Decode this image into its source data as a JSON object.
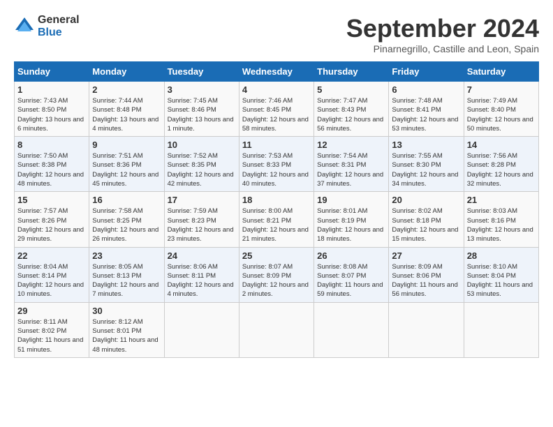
{
  "header": {
    "logo_line1": "General",
    "logo_line2": "Blue",
    "month_title": "September 2024",
    "location": "Pinarnegrillo, Castille and Leon, Spain"
  },
  "weekdays": [
    "Sunday",
    "Monday",
    "Tuesday",
    "Wednesday",
    "Thursday",
    "Friday",
    "Saturday"
  ],
  "weeks": [
    [
      {
        "day": "1",
        "info": "Sunrise: 7:43 AM\nSunset: 8:50 PM\nDaylight: 13 hours and 6 minutes."
      },
      {
        "day": "2",
        "info": "Sunrise: 7:44 AM\nSunset: 8:48 PM\nDaylight: 13 hours and 4 minutes."
      },
      {
        "day": "3",
        "info": "Sunrise: 7:45 AM\nSunset: 8:46 PM\nDaylight: 13 hours and 1 minute."
      },
      {
        "day": "4",
        "info": "Sunrise: 7:46 AM\nSunset: 8:45 PM\nDaylight: 12 hours and 58 minutes."
      },
      {
        "day": "5",
        "info": "Sunrise: 7:47 AM\nSunset: 8:43 PM\nDaylight: 12 hours and 56 minutes."
      },
      {
        "day": "6",
        "info": "Sunrise: 7:48 AM\nSunset: 8:41 PM\nDaylight: 12 hours and 53 minutes."
      },
      {
        "day": "7",
        "info": "Sunrise: 7:49 AM\nSunset: 8:40 PM\nDaylight: 12 hours and 50 minutes."
      }
    ],
    [
      {
        "day": "8",
        "info": "Sunrise: 7:50 AM\nSunset: 8:38 PM\nDaylight: 12 hours and 48 minutes."
      },
      {
        "day": "9",
        "info": "Sunrise: 7:51 AM\nSunset: 8:36 PM\nDaylight: 12 hours and 45 minutes."
      },
      {
        "day": "10",
        "info": "Sunrise: 7:52 AM\nSunset: 8:35 PM\nDaylight: 12 hours and 42 minutes."
      },
      {
        "day": "11",
        "info": "Sunrise: 7:53 AM\nSunset: 8:33 PM\nDaylight: 12 hours and 40 minutes."
      },
      {
        "day": "12",
        "info": "Sunrise: 7:54 AM\nSunset: 8:31 PM\nDaylight: 12 hours and 37 minutes."
      },
      {
        "day": "13",
        "info": "Sunrise: 7:55 AM\nSunset: 8:30 PM\nDaylight: 12 hours and 34 minutes."
      },
      {
        "day": "14",
        "info": "Sunrise: 7:56 AM\nSunset: 8:28 PM\nDaylight: 12 hours and 32 minutes."
      }
    ],
    [
      {
        "day": "15",
        "info": "Sunrise: 7:57 AM\nSunset: 8:26 PM\nDaylight: 12 hours and 29 minutes."
      },
      {
        "day": "16",
        "info": "Sunrise: 7:58 AM\nSunset: 8:25 PM\nDaylight: 12 hours and 26 minutes."
      },
      {
        "day": "17",
        "info": "Sunrise: 7:59 AM\nSunset: 8:23 PM\nDaylight: 12 hours and 23 minutes."
      },
      {
        "day": "18",
        "info": "Sunrise: 8:00 AM\nSunset: 8:21 PM\nDaylight: 12 hours and 21 minutes."
      },
      {
        "day": "19",
        "info": "Sunrise: 8:01 AM\nSunset: 8:19 PM\nDaylight: 12 hours and 18 minutes."
      },
      {
        "day": "20",
        "info": "Sunrise: 8:02 AM\nSunset: 8:18 PM\nDaylight: 12 hours and 15 minutes."
      },
      {
        "day": "21",
        "info": "Sunrise: 8:03 AM\nSunset: 8:16 PM\nDaylight: 12 hours and 13 minutes."
      }
    ],
    [
      {
        "day": "22",
        "info": "Sunrise: 8:04 AM\nSunset: 8:14 PM\nDaylight: 12 hours and 10 minutes."
      },
      {
        "day": "23",
        "info": "Sunrise: 8:05 AM\nSunset: 8:13 PM\nDaylight: 12 hours and 7 minutes."
      },
      {
        "day": "24",
        "info": "Sunrise: 8:06 AM\nSunset: 8:11 PM\nDaylight: 12 hours and 4 minutes."
      },
      {
        "day": "25",
        "info": "Sunrise: 8:07 AM\nSunset: 8:09 PM\nDaylight: 12 hours and 2 minutes."
      },
      {
        "day": "26",
        "info": "Sunrise: 8:08 AM\nSunset: 8:07 PM\nDaylight: 11 hours and 59 minutes."
      },
      {
        "day": "27",
        "info": "Sunrise: 8:09 AM\nSunset: 8:06 PM\nDaylight: 11 hours and 56 minutes."
      },
      {
        "day": "28",
        "info": "Sunrise: 8:10 AM\nSunset: 8:04 PM\nDaylight: 11 hours and 53 minutes."
      }
    ],
    [
      {
        "day": "29",
        "info": "Sunrise: 8:11 AM\nSunset: 8:02 PM\nDaylight: 11 hours and 51 minutes."
      },
      {
        "day": "30",
        "info": "Sunrise: 8:12 AM\nSunset: 8:01 PM\nDaylight: 11 hours and 48 minutes."
      },
      {
        "day": "",
        "info": ""
      },
      {
        "day": "",
        "info": ""
      },
      {
        "day": "",
        "info": ""
      },
      {
        "day": "",
        "info": ""
      },
      {
        "day": "",
        "info": ""
      }
    ]
  ]
}
